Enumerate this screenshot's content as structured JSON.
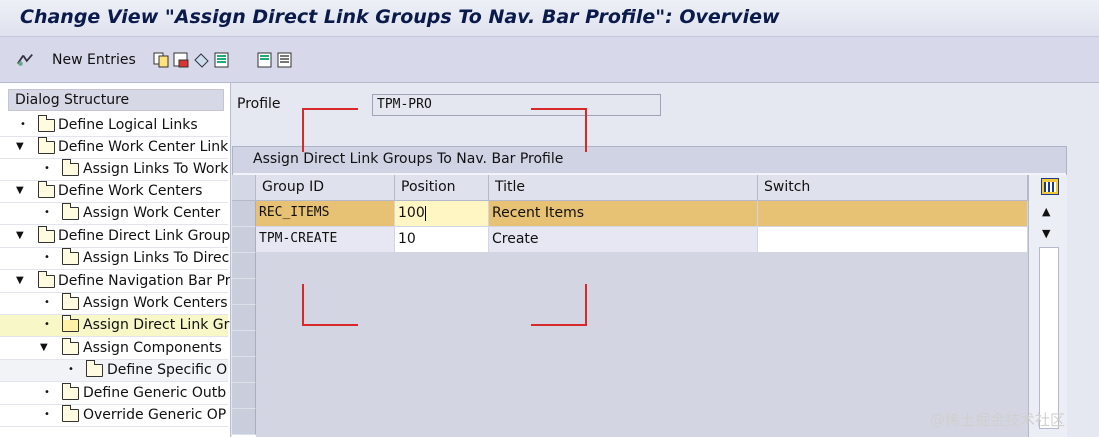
{
  "title": "Change View \"Assign Direct Link Groups To Nav. Bar Profile\": Overview",
  "toolbar": {
    "new_entries": "New Entries",
    "icons": [
      "glasses-icon",
      "copy-icon",
      "delete-icon",
      "undo-icon",
      "select-all-icon",
      "select-block-icon",
      "deselect-all-icon"
    ]
  },
  "dialog": {
    "header": "Dialog Structure",
    "items": [
      {
        "label": "Define Logical Links"
      },
      {
        "label": "Define Work Center Link"
      },
      {
        "label": "Assign Links To Work"
      },
      {
        "label": "Define Work Centers"
      },
      {
        "label": "Assign Work Center"
      },
      {
        "label": "Define Direct Link Group"
      },
      {
        "label": "Assign Links To Direc"
      },
      {
        "label": "Define Navigation Bar Pr"
      },
      {
        "label": "Assign Work Centers"
      },
      {
        "label": "Assign Direct Link Gr"
      },
      {
        "label": "Assign Components"
      },
      {
        "label": "Define Specific O"
      },
      {
        "label": "Define Generic Outb"
      },
      {
        "label": "Override Generic OP"
      }
    ]
  },
  "profile": {
    "label": "Profile",
    "value": "TPM-PRO"
  },
  "table": {
    "title": "Assign Direct Link Groups To Nav. Bar Profile",
    "columns": [
      "Group ID",
      "Position",
      "Title",
      "Switch"
    ],
    "rows": [
      {
        "group_id": "REC_ITEMS",
        "position": "100",
        "title": "Recent Items",
        "switch": ""
      },
      {
        "group_id": "TPM-CREATE",
        "position": "10",
        "title": "Create",
        "switch": ""
      }
    ]
  },
  "colors": {
    "accent_row": "#e8c274",
    "selected_tree": "#f7f7c8",
    "annotation": "#d7282a"
  },
  "watermark": "@稀土掘金技术社区"
}
